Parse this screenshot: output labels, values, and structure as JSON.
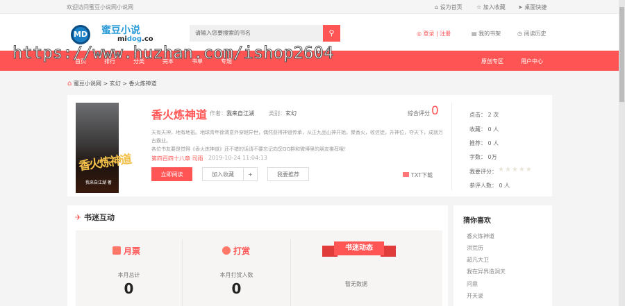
{
  "topbar": {
    "welcome": "欢迎访问蜜豆小说网小说网",
    "links": [
      "设为首页",
      "加入收藏",
      "桌面快捷"
    ]
  },
  "header": {
    "logo_mark": "MD",
    "logo_cn": "蜜豆小说",
    "logo_en_a": "mi",
    "logo_en_b": "dog",
    "logo_en_c": ".co",
    "search_placeholder": "请输入您要搜索的书名",
    "login": "登录 | 注册",
    "bookshelf": "我的书架",
    "history": "阅读历史"
  },
  "nav": {
    "items": [
      "首页",
      "排行",
      "分类",
      "完本",
      "书单",
      "专题"
    ],
    "right": [
      "原创专区",
      "用户中心"
    ]
  },
  "watermark": "https://www.huzhan.com/ishop2604",
  "breadcrumb": [
    "蜜豆小说网",
    "玄幻",
    "香火炼神道"
  ],
  "book": {
    "title": "香火炼神道",
    "author_label": "作者：",
    "author": "我来自江湖",
    "category_label": "类别：",
    "category": "玄幻",
    "score_label": "综合评分",
    "score": "0",
    "cover_title": "香火炼神道",
    "cover_author": "我来自江湖 著",
    "desc1": "天有天神，地有地祇。地球青年徐渭意外穿越异世，偶然获得神道传承，从正九品山神开始，聚香火，收信徒，升神位，夺天下，成就万古霸业。",
    "desc2": "各位书友要是觉得《香火炼神道》还不错的话请不要忘记向您QQ群和微博里的朋友推荐哦！",
    "latest_chapter": "第四百四十八章 司雨",
    "update_time": "2019-10-24 11:04:13",
    "read_btn": "立即阅读",
    "collect_btn": "加入收藏",
    "plus": "+",
    "recommend_btn": "我要推荐",
    "txt_download": "TXT下载"
  },
  "stats": {
    "clicks": "点击：  2 次",
    "collects": "收藏：  0 人",
    "recommends": "推荐：  0 人",
    "words": "字数：  0万",
    "rate_label": "我要评分：",
    "raters": "参评人数：  0 人",
    "rating": 0
  },
  "interaction": {
    "title": "书迷互动",
    "monthly": {
      "title": "月票",
      "label": "本月总计",
      "value": "0"
    },
    "reward": {
      "title": "打赏",
      "label": "本月打赏人数",
      "value": "0"
    },
    "dynamics": {
      "title": "书迷动态",
      "empty": "暂无数据"
    }
  },
  "guess": {
    "title": "猜你喜欢",
    "items": [
      "香火炼神道",
      "洪荒历",
      "超凡大卫",
      "我在异界造洞天",
      "问鼎",
      "开天录"
    ]
  }
}
